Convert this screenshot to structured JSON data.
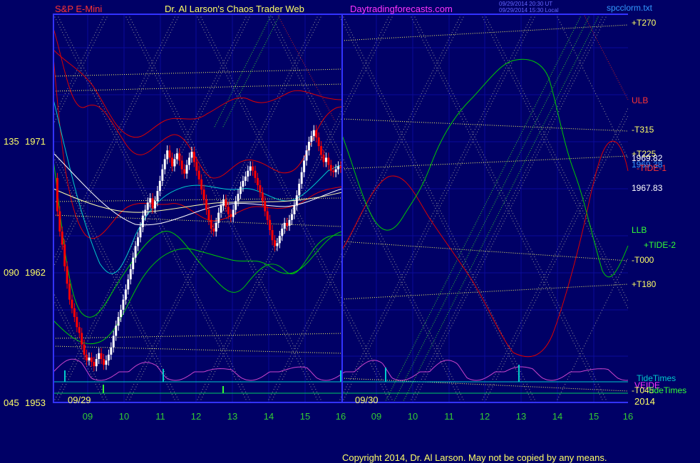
{
  "header": {
    "instrument": "S&P E-Mini",
    "title": "Dr. Al Larson's Chaos Trader Web",
    "site": "Daytradingforecasts.com",
    "timestamp_1": "09/29/2014 20:30 UT",
    "timestamp_2": "09/29/2014 15:30 Local",
    "file": "spcclorm.txt"
  },
  "footer": {
    "copyright": "Copyright 2014, Dr. Al Larson. May not be copied by any means."
  },
  "colors": {
    "background": "#000066",
    "frame": "#3333ff",
    "grid": "#0a0a99",
    "dotted": "#aaaaaa",
    "price_up": "#ffffff",
    "price_down": "#ff0000",
    "red_band": "#e00000",
    "green_band": "#00cc00",
    "tide": "#cc44cc",
    "cyan": "#00cccc",
    "yellow": "#ffff66",
    "label_gold": "#ffff66",
    "label_red": "#ff3333",
    "label_green": "#33ff33",
    "label_magenta": "#ff33ff",
    "axis_green": "#33cc33"
  },
  "chart_data": {
    "type": "line",
    "y_axis": {
      "labels": [
        {
          "left": "135",
          "right": "1971"
        },
        {
          "left": "090",
          "right": "1962"
        },
        {
          "left": "045",
          "right": "1953"
        }
      ],
      "ylim": [
        1953,
        1971
      ]
    },
    "x_axis": {
      "ticks": [
        "09",
        "10",
        "11",
        "12",
        "13",
        "14",
        "15",
        "16",
        "09",
        "10",
        "11",
        "12",
        "13",
        "14",
        "15",
        "16"
      ],
      "dates": [
        "09/29",
        "09/30"
      ],
      "year": "2014"
    },
    "price_labels": [
      "1969.82",
      "1969.38",
      "1967.83"
    ],
    "right_labels": [
      {
        "text": "+T270",
        "color": "yellow"
      },
      {
        "text": "ULB",
        "color": "red"
      },
      {
        "text": "-T315",
        "color": "yellow"
      },
      {
        "text": "+T225",
        "color": "yellow"
      },
      {
        "text": "-TIDE-1",
        "color": "red"
      },
      {
        "text": "LLB",
        "color": "green"
      },
      {
        "text": "+TIDE-2",
        "color": "green"
      },
      {
        "text": "-T000",
        "color": "yellow"
      },
      {
        "text": "+T180",
        "color": "yellow"
      },
      {
        "text": "TideTimes",
        "color": "cyan"
      },
      {
        "text": "VEIDE",
        "color": "magenta"
      },
      {
        "text": "-T045",
        "color": "yellow"
      },
      {
        "text": "TideTimes",
        "color": "green"
      }
    ],
    "series": [
      {
        "type": "candles",
        "values": [
          1968.5,
          1966.2,
          1964.8,
          1963.9,
          1962.4,
          1961.2,
          1960.1,
          1959.5,
          1958.9,
          1958.2,
          1957.8,
          1957.0,
          1956.3,
          1955.9,
          1956.1,
          1955.8,
          1955.5,
          1956.0,
          1956.4,
          1956.0,
          1955.6,
          1955.9,
          1956.3,
          1956.8,
          1957.6,
          1958.3,
          1958.9,
          1959.4,
          1960.1,
          1960.8,
          1961.5,
          1962.2,
          1963.0,
          1963.8,
          1964.4,
          1965.1,
          1965.9,
          1966.3,
          1966.8,
          1967.1,
          1966.4,
          1966.9,
          1967.6,
          1968.3,
          1969.1,
          1969.8,
          1970.4,
          1969.9,
          1969.3,
          1969.8,
          1970.2,
          1969.7,
          1969.1,
          1968.8,
          1969.4,
          1969.9,
          1970.3,
          1969.6,
          1969.0,
          1968.4,
          1967.7,
          1967.0,
          1966.3,
          1965.6,
          1965.0,
          1964.8,
          1965.4,
          1966.1,
          1966.6,
          1967.0,
          1966.5,
          1966.0,
          1965.8,
          1966.3,
          1966.9,
          1967.4,
          1967.9,
          1968.3,
          1968.6,
          1969.0,
          1969.3,
          1969.0,
          1968.5,
          1968.0,
          1967.5,
          1966.9,
          1966.2,
          1965.6,
          1964.9,
          1964.2,
          1963.8,
          1964.0,
          1964.5,
          1965.0,
          1965.4,
          1965.2,
          1965.6,
          1966.0,
          1966.6,
          1967.3,
          1968.1,
          1968.9,
          1969.7,
          1970.4,
          1971.0,
          1971.4,
          1971.8,
          1971.3,
          1970.7,
          1970.1,
          1969.6,
          1969.9,
          1969.4,
          1969.0,
          1968.9,
          1969.1,
          1969.3,
          1969.2
        ]
      }
    ]
  }
}
